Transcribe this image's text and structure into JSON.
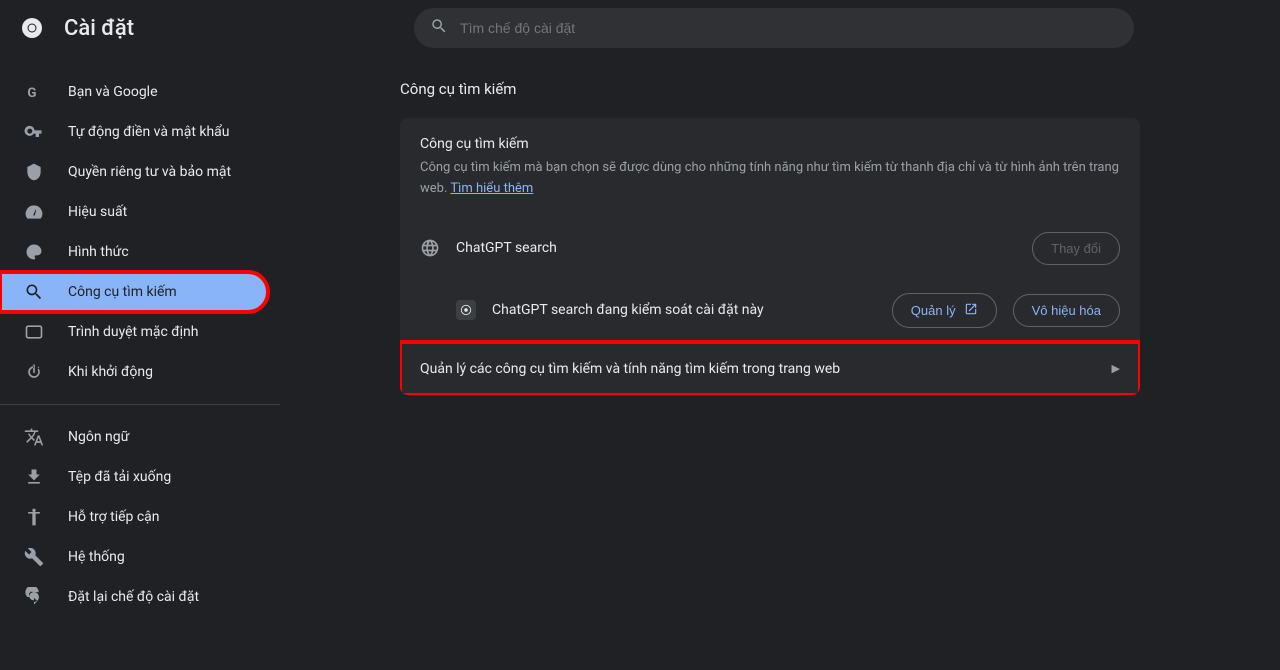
{
  "header": {
    "title": "Cài đặt",
    "search_placeholder": "Tìm chế độ cài đặt"
  },
  "sidebar": {
    "items": [
      {
        "icon": "google",
        "label": "Bạn và Google"
      },
      {
        "icon": "key",
        "label": "Tự động điền và mật khẩu"
      },
      {
        "icon": "shield",
        "label": "Quyền riêng tư và bảo mật"
      },
      {
        "icon": "speed",
        "label": "Hiệu suất"
      },
      {
        "icon": "palette",
        "label": "Hình thức"
      },
      {
        "icon": "search",
        "label": "Công cụ tìm kiếm"
      },
      {
        "icon": "browser",
        "label": "Trình duyệt mặc định"
      },
      {
        "icon": "power",
        "label": "Khi khởi động"
      }
    ],
    "items2": [
      {
        "icon": "language",
        "label": "Ngôn ngữ"
      },
      {
        "icon": "download",
        "label": "Tệp đã tải xuống"
      },
      {
        "icon": "accessibility",
        "label": "Hỗ trợ tiếp cận"
      },
      {
        "icon": "system",
        "label": "Hệ thống"
      },
      {
        "icon": "reset",
        "label": "Đặt lại chế độ cài đặt"
      }
    ]
  },
  "main": {
    "section_title": "Công cụ tìm kiếm",
    "card": {
      "heading": "Công cụ tìm kiếm",
      "description": "Công cụ tìm kiếm mà bạn chọn sẽ được dùng cho những tính năng như tìm kiếm từ thanh địa chỉ và từ hình ảnh trên trang web. ",
      "learn_more": "Tìm hiểu thêm",
      "current_engine": "ChatGPT search",
      "change_btn": "Thay đổi",
      "controlled_by": "ChatGPT search đang kiểm soát cài đặt này",
      "manage_btn": "Quản lý",
      "disable_btn": "Vô hiệu hóa",
      "manage_row": "Quản lý các công cụ tìm kiếm và tính năng tìm kiếm trong trang web"
    }
  }
}
